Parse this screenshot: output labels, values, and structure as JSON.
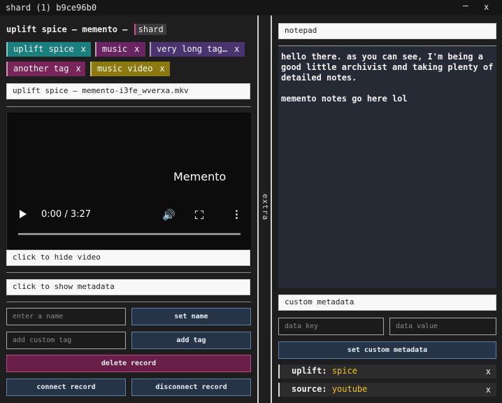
{
  "window": {
    "title": "shard (1) b9ce96b0",
    "minimize": "–",
    "close": "x"
  },
  "record": {
    "title": "uplift spice – memento –",
    "badge": "shard"
  },
  "tags": [
    {
      "label": "uplift spice",
      "remove": "x",
      "color": "#1a7f7d"
    },
    {
      "label": "music",
      "remove": "x",
      "color": "#6a2462"
    },
    {
      "label": "very long tag…",
      "remove": "x",
      "color": "#4a3470"
    },
    {
      "label": "another tag",
      "remove": "x",
      "color": "#7a2559"
    },
    {
      "label": "music video",
      "remove": "x",
      "color": "#8c7a0f"
    }
  ],
  "filename": "uplift spice – memento-i3fe_wverxa.mkv",
  "video": {
    "overlay_title": "Memento",
    "time": "0:00 / 3:27",
    "hide_label": "click to hide video"
  },
  "metadata_toggle": "click to show metadata",
  "name_input": {
    "placeholder": "enter a name",
    "button": "set name"
  },
  "tag_input": {
    "placeholder": "add custom tag",
    "button": "add tag"
  },
  "delete_button": "delete record",
  "connect_button": "connect record",
  "disconnect_button": "disconnect record",
  "extra_label": "extra",
  "notepad": {
    "title": "notepad",
    "text": "hello there. as you can see, I'm being a good little archivist and taking plenty of detailed notes.\n\nmemento notes go here lol"
  },
  "custom_metadata": {
    "title": "custom metadata",
    "key_placeholder": "data key",
    "value_placeholder": "data value",
    "button": "set custom metadata",
    "entries": [
      {
        "key": "uplift:",
        "value": "spice",
        "remove": "x"
      },
      {
        "key": "source:",
        "value": "youtube",
        "remove": "x"
      }
    ]
  }
}
